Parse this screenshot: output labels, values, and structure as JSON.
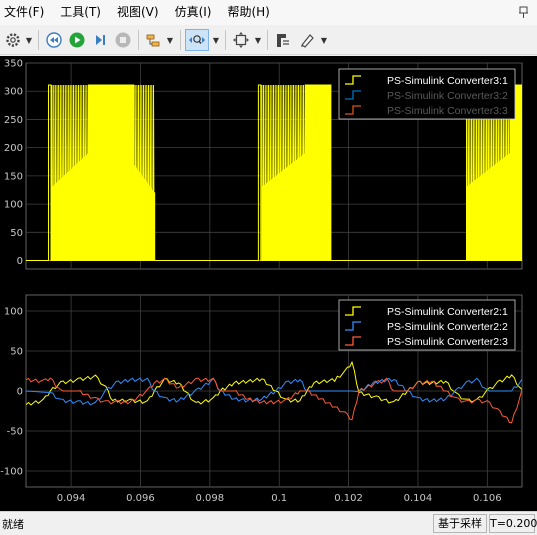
{
  "menubar": {
    "items": [
      "文件(F)",
      "工具(T)",
      "视图(V)",
      "仿真(I)",
      "帮助(H)"
    ]
  },
  "toolbar": {
    "icons": [
      "gear-icon",
      "rewind-icon",
      "run-icon",
      "step-forward-icon",
      "stop-icon",
      "signal-highlight-icon",
      "zoom-x-icon",
      "fit-to-view-icon",
      "cursor-measure-icon",
      "style-brush-icon"
    ]
  },
  "colors": {
    "background": "#000000",
    "axes_background": "#000000",
    "grid": "#404040",
    "tick_text": "#c8c8c8",
    "series_yellow": "#ffff00",
    "series_blue": "#0072bd",
    "series_blue2": "#2f8fff",
    "series_orange": "#ff5a36"
  },
  "statusbar": {
    "status": "就绪",
    "mode": "基于采样",
    "time": "T=0.200"
  },
  "chart_data": [
    {
      "type": "line",
      "title": "",
      "xlabel": "",
      "ylabel": "",
      "xlim": [
        0.0927,
        0.107
      ],
      "ylim": [
        -15,
        350
      ],
      "yticks": [
        0,
        50,
        100,
        150,
        200,
        250,
        300,
        350
      ],
      "grid": true,
      "legend_position": "top-right",
      "series": [
        {
          "name": "PS-Simulink Converter3:1",
          "color": "#ffff00",
          "segments": [
            {
              "kind": "pulse",
              "x_start": 0.09335,
              "x_end": 0.09342,
              "peak": 311
            },
            {
              "kind": "ramp_pwm",
              "x_start": 0.09345,
              "x_end": 0.0945,
              "base_start": 130,
              "base_end": 190,
              "peak": 311
            },
            {
              "kind": "full_pwm",
              "x_start": 0.0945,
              "x_end": 0.0958,
              "peak": 311
            },
            {
              "kind": "ramp_pwm",
              "x_start": 0.0958,
              "x_end": 0.0964,
              "base_start": 170,
              "base_end": 120,
              "peak": 311
            },
            {
              "kind": "pulse",
              "x_start": 0.0994,
              "x_end": 0.09947,
              "peak": 311
            },
            {
              "kind": "ramp_pwm",
              "x_start": 0.0995,
              "x_end": 0.10075,
              "base_start": 130,
              "base_end": 190,
              "peak": 311
            },
            {
              "kind": "full_pwm",
              "x_start": 0.10075,
              "x_end": 0.10148,
              "peak": 311
            },
            {
              "kind": "ramp_pwm",
              "x_start": 0.1054,
              "x_end": 0.10665,
              "base_start": 130,
              "base_end": 190,
              "peak": 311
            },
            {
              "kind": "full_pwm",
              "x_start": 0.10665,
              "x_end": 0.1076,
              "peak": 311
            }
          ],
          "baseline": 0
        },
        {
          "name": "PS-Simulink Converter3:2",
          "color": "#0072bd",
          "values": "flat at 0"
        },
        {
          "name": "PS-Simulink Converter3:3",
          "color": "#d95319",
          "values": "flat at 0"
        }
      ]
    },
    {
      "type": "line",
      "title": "",
      "xlabel": "",
      "ylabel": "",
      "xlim": [
        0.0927,
        0.107
      ],
      "ylim": [
        -120,
        120
      ],
      "xticks": [
        0.094,
        0.096,
        0.098,
        0.1,
        0.102,
        0.104,
        0.106
      ],
      "xticklabels": [
        "0.094",
        "0.096",
        "0.098",
        "0.1",
        "0.102",
        "0.104",
        "0.106"
      ],
      "yticks": [
        -100,
        -50,
        0,
        50,
        100
      ],
      "grid": true,
      "legend_position": "top-right",
      "series": [
        {
          "name": "PS-Simulink Converter2:1",
          "color": "#ffff00",
          "points": [
            [
              0.0927,
              -17
            ],
            [
              0.0932,
              -12
            ],
            [
              0.0934,
              0
            ],
            [
              0.0937,
              10
            ],
            [
              0.0942,
              14
            ],
            [
              0.0947,
              18
            ],
            [
              0.095,
              4
            ],
            [
              0.0952,
              -12
            ],
            [
              0.0957,
              -12
            ],
            [
              0.0962,
              -14
            ],
            [
              0.0964,
              0
            ],
            [
              0.0967,
              14
            ],
            [
              0.0971,
              10
            ],
            [
              0.0976,
              -16
            ],
            [
              0.0981,
              -10
            ],
            [
              0.0983,
              0
            ],
            [
              0.0987,
              10
            ],
            [
              0.0991,
              12
            ],
            [
              0.0995,
              15
            ],
            [
              0.0999,
              0
            ],
            [
              0.1002,
              -12
            ],
            [
              0.1006,
              -12
            ],
            [
              0.1008,
              0
            ],
            [
              0.101,
              10
            ],
            [
              0.1016,
              14
            ],
            [
              0.1019,
              24
            ],
            [
              0.1021,
              36
            ],
            [
              0.1023,
              -2
            ],
            [
              0.1028,
              -8
            ],
            [
              0.1033,
              -15
            ],
            [
              0.1037,
              0
            ],
            [
              0.104,
              10
            ],
            [
              0.1044,
              10
            ],
            [
              0.1048,
              12
            ],
            [
              0.1051,
              -4
            ],
            [
              0.1054,
              -12
            ],
            [
              0.1057,
              -12
            ],
            [
              0.106,
              0
            ],
            [
              0.1063,
              10
            ],
            [
              0.1067,
              20
            ],
            [
              0.107,
              0
            ],
            [
              0.1072,
              -15
            ]
          ]
        },
        {
          "name": "PS-Simulink Converter2:2",
          "color": "#2f8fff",
          "points": [
            [
              0.0927,
              0
            ],
            [
              0.0934,
              -2
            ],
            [
              0.0937,
              -12
            ],
            [
              0.0942,
              -14
            ],
            [
              0.0947,
              -16
            ],
            [
              0.095,
              0
            ],
            [
              0.0953,
              10
            ],
            [
              0.0957,
              14
            ],
            [
              0.0962,
              14
            ],
            [
              0.0964,
              0
            ],
            [
              0.0967,
              -10
            ],
            [
              0.0971,
              -12
            ],
            [
              0.0976,
              0
            ],
            [
              0.0981,
              14
            ],
            [
              0.0983,
              0
            ],
            [
              0.0987,
              -10
            ],
            [
              0.0991,
              -12
            ],
            [
              0.0995,
              -10
            ],
            [
              0.0999,
              0
            ],
            [
              0.1002,
              10
            ],
            [
              0.1006,
              14
            ],
            [
              0.1008,
              0
            ],
            [
              0.101,
              0
            ],
            [
              0.1021,
              0
            ],
            [
              0.1023,
              -1
            ],
            [
              0.1027,
              10
            ],
            [
              0.1031,
              14
            ],
            [
              0.1033,
              14
            ],
            [
              0.1037,
              0
            ],
            [
              0.104,
              -10
            ],
            [
              0.1044,
              -12
            ],
            [
              0.1048,
              -10
            ],
            [
              0.1051,
              0
            ],
            [
              0.1054,
              10
            ],
            [
              0.1057,
              14
            ],
            [
              0.106,
              0
            ],
            [
              0.1062,
              0
            ],
            [
              0.1067,
              0
            ],
            [
              0.107,
              13
            ]
          ]
        },
        {
          "name": "PS-Simulink Converter2:3",
          "color": "#ff5a36",
          "points": [
            [
              0.0927,
              14
            ],
            [
              0.0932,
              12
            ],
            [
              0.0934,
              16
            ],
            [
              0.0937,
              0
            ],
            [
              0.0942,
              0
            ],
            [
              0.0947,
              -10
            ],
            [
              0.095,
              -14
            ],
            [
              0.0953,
              -14
            ],
            [
              0.0957,
              -14
            ],
            [
              0.0962,
              0
            ],
            [
              0.0964,
              10
            ],
            [
              0.0967,
              14
            ],
            [
              0.0971,
              4
            ],
            [
              0.0976,
              14
            ],
            [
              0.0981,
              14
            ],
            [
              0.0983,
              0
            ],
            [
              0.0987,
              0
            ],
            [
              0.0991,
              -10
            ],
            [
              0.0995,
              -14
            ],
            [
              0.0999,
              -14
            ],
            [
              0.1002,
              -12
            ],
            [
              0.1006,
              0
            ],
            [
              0.1008,
              0
            ],
            [
              0.1012,
              -10
            ],
            [
              0.1016,
              -20
            ],
            [
              0.1019,
              -28
            ],
            [
              0.1021,
              -36
            ],
            [
              0.1023,
              0
            ],
            [
              0.1028,
              10
            ],
            [
              0.1031,
              14
            ],
            [
              0.1033,
              0
            ],
            [
              0.1037,
              0
            ],
            [
              0.104,
              10
            ],
            [
              0.1044,
              12
            ],
            [
              0.1048,
              0
            ],
            [
              0.1051,
              -10
            ],
            [
              0.1054,
              -14
            ],
            [
              0.1057,
              -12
            ],
            [
              0.106,
              -14
            ],
            [
              0.1063,
              -24
            ],
            [
              0.1067,
              -40
            ],
            [
              0.107,
              0
            ],
            [
              0.1072,
              -2
            ]
          ]
        }
      ]
    }
  ]
}
